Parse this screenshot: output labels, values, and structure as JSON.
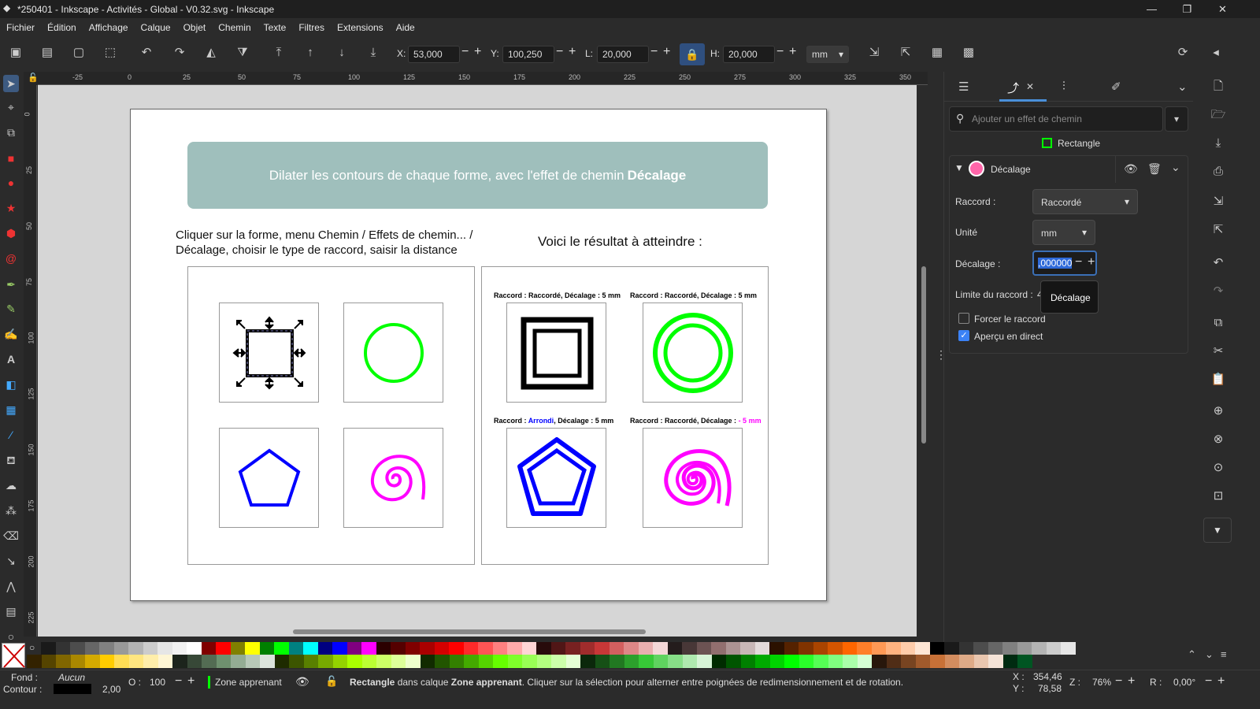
{
  "window": {
    "title": "*250401 - Inkscape - Activités - Global - V0.32.svg - Inkscape",
    "minimize": "—",
    "maximize": "❐",
    "close": "✕"
  },
  "menu": [
    "Fichier",
    "Édition",
    "Affichage",
    "Calque",
    "Objet",
    "Chemin",
    "Texte",
    "Filtres",
    "Extensions",
    "Aide"
  ],
  "toolbar": {
    "x_label": "X:",
    "x_value": "53,000",
    "y_label": "Y:",
    "y_value": "100,250",
    "w_label": "L:",
    "w_value": "20,000",
    "h_label": "H:",
    "h_value": "20,000",
    "unit": "mm"
  },
  "rulers": {
    "h_ticks": [
      "-25",
      "0",
      "25",
      "50",
      "75",
      "100",
      "125",
      "150",
      "175",
      "200",
      "225",
      "250",
      "275",
      "300",
      "325",
      "350"
    ],
    "v_ticks": [
      "0",
      "25",
      "50",
      "75",
      "100",
      "125",
      "150",
      "175",
      "200",
      "225"
    ]
  },
  "document": {
    "banner_text": "Dilater les contours de chaque forme, avec l'effet de chemin ",
    "banner_bold": "Décalage",
    "instruction_line1": "Cliquer sur la forme, menu Chemin / Effets de chemin... /",
    "instruction_line2": "Décalage, choisir le type de raccord, saisir la distance",
    "result_title": "Voici le résultat à atteindre :",
    "caption1": "Raccord : Raccordé, Décalage : 5 mm",
    "caption2": "Raccord : Raccordé, Décalage : 5 mm",
    "caption3_a": "Raccord : ",
    "caption3_b": "Arrondi",
    "caption3_c": ", Décalage : 5 mm",
    "caption4_a": "Raccord : Raccordé, Décalage : ",
    "caption4_b": "- 5 mm",
    "colors": {
      "green": "#00ff00",
      "blue": "#0000ff",
      "magenta": "#ff00ff",
      "arrondi": "#0000ff",
      "neg": "#ff00ff",
      "banner": "#9fbfbc"
    }
  },
  "panel": {
    "search_placeholder": "Ajouter un effet de chemin",
    "object_label": "Rectangle",
    "effect_name": "Décalage",
    "raccord_label": "Raccord :",
    "raccord_value": "Raccordé",
    "unit_label": "Unité",
    "unit_value": "mm",
    "offset_label": "Décalage :",
    "offset_value": ",000000",
    "limit_label": "Limite du raccord :",
    "limit_value": "4",
    "tooltip": "Décalage",
    "force_label": "Forcer le raccord",
    "preview_label": "Aperçu en direct"
  },
  "palette": {
    "row1": [
      "#1a1a1a",
      "#333333",
      "#4d4d4d",
      "#666666",
      "#808080",
      "#999999",
      "#b3b3b3",
      "#cccccc",
      "#e6e6e6",
      "#f2f2f2",
      "#ffffff",
      "#800000",
      "#ff0000",
      "#808000",
      "#ffff00",
      "#008000",
      "#00ff00",
      "#008080",
      "#00ffff",
      "#000080",
      "#0000ff",
      "#800080",
      "#ff00ff",
      "#2b0000",
      "#550000",
      "#800000",
      "#aa0000",
      "#d40000",
      "#ff0000",
      "#ff2a2a",
      "#ff5555",
      "#ff8080",
      "#ffaaaa",
      "#ffd5d5",
      "#280b0b",
      "#501616",
      "#782121",
      "#a02c2c",
      "#c83737",
      "#d35f5f",
      "#de8787",
      "#e9afaf",
      "#f4d7d7",
      "#241c1c",
      "#483737",
      "#6c5353",
      "#916f6f",
      "#ac9393",
      "#c8b7b7",
      "#e3dbdb",
      "#2b1100",
      "#552200",
      "#803300",
      "#aa4400",
      "#d45500",
      "#ff6600",
      "#ff7f2a",
      "#ff9955",
      "#ffb380",
      "#ffccaa",
      "#ffe6d5",
      "#000000",
      "#1a1a1a",
      "#333333",
      "#4d4d4d",
      "#666666",
      "#808080",
      "#999999",
      "#b3b3b3",
      "#cccccc",
      "#e6e6e6"
    ],
    "row2": [
      "#332200",
      "#554400",
      "#806600",
      "#aa8800",
      "#d4aa00",
      "#ffcc00",
      "#ffdd55",
      "#ffe680",
      "#ffeeaa",
      "#fff6d5",
      "#1c241c",
      "#374837",
      "#536c53",
      "#6f916f",
      "#93ac93",
      "#b7c8b7",
      "#dbe3db",
      "#1e2b00",
      "#3c5500",
      "#598000",
      "#77aa00",
      "#94d400",
      "#aaff00",
      "#bbff33",
      "#ccff66",
      "#ddff99",
      "#eeffcc",
      "#112b00",
      "#225500",
      "#338000",
      "#44aa00",
      "#55d400",
      "#66ff00",
      "#7fff2a",
      "#99ff55",
      "#b3ff80",
      "#ccffaa",
      "#e5ffd5",
      "#0b280b",
      "#165016",
      "#217821",
      "#2ca02c",
      "#37c837",
      "#5fd35f",
      "#87de87",
      "#afe9af",
      "#d7f4d7",
      "#002b00",
      "#005500",
      "#008000",
      "#00aa00",
      "#00d400",
      "#00ff00",
      "#2aff2a",
      "#55ff55",
      "#80ff80",
      "#aaffaa",
      "#d5ffd5",
      "#28170b",
      "#502d16",
      "#784421",
      "#a05a2c",
      "#c87137",
      "#d38d5f",
      "#deaa87",
      "#e9c6af",
      "#f4e3d7",
      "#002b11",
      "#005522"
    ]
  },
  "status": {
    "fill_label": "Fond :",
    "fill_value": "Aucun",
    "stroke_label": "Contour :",
    "stroke_width": "2,00",
    "opacity_label": "O :",
    "opacity_value": "100",
    "layer": "Zone apprenant",
    "msg_bold1": "Rectangle",
    "msg_mid": " dans calque ",
    "msg_bold2": "Zone apprenant",
    "msg_end": ". Cliquer sur la sélection pour alterner entre poignées de redimensionnement et de rotation.",
    "x_label": "X :",
    "x_value": "354,46",
    "y_label": "Y :",
    "y_value": "78,58",
    "zoom_label": "Z :",
    "zoom_value": "76%",
    "rot_label": "R :",
    "rot_value": "0,00°"
  }
}
